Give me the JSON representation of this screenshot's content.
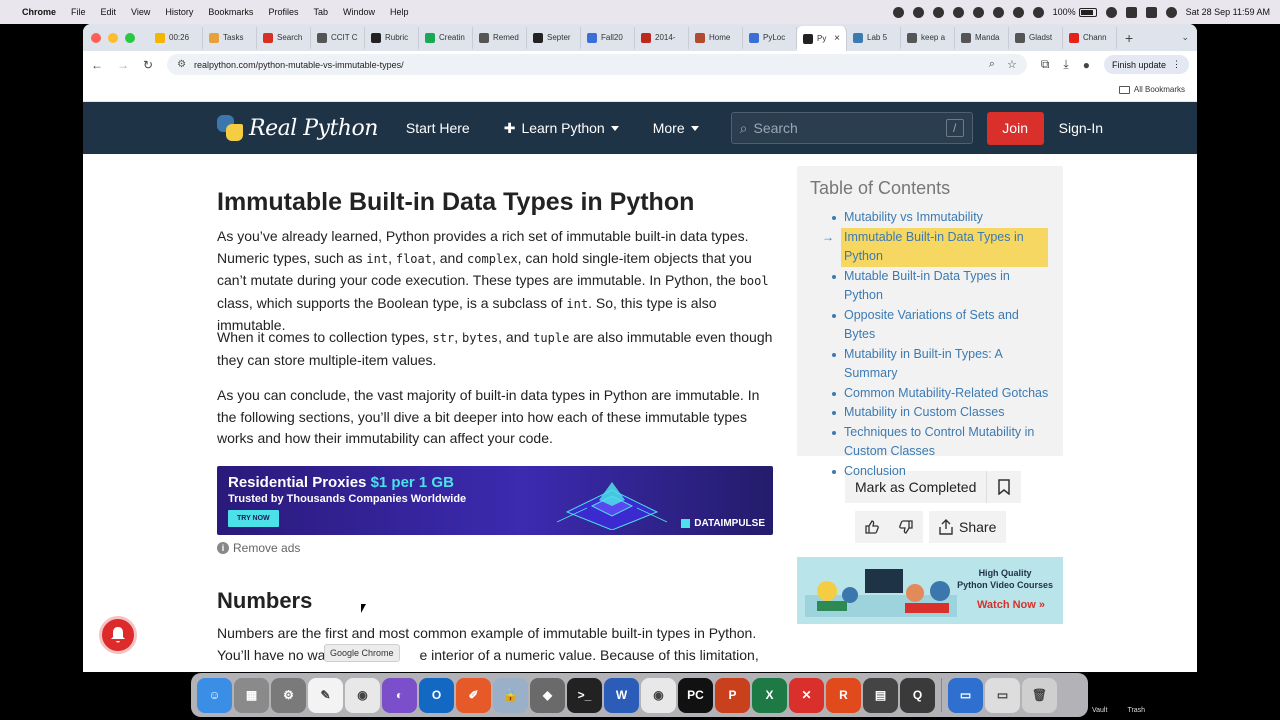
{
  "menubar": {
    "app": "Chrome",
    "items": [
      "File",
      "Edit",
      "View",
      "History",
      "Bookmarks",
      "Profiles",
      "Tab",
      "Window",
      "Help"
    ],
    "battery": "100%",
    "datetime": "Sat 28 Sep  11:59 AM"
  },
  "tabs": [
    {
      "label": "00:26",
      "color": "#f4b400"
    },
    {
      "label": "Tasks",
      "color": "#e8a13a"
    },
    {
      "label": "Search",
      "color": "#d93025"
    },
    {
      "label": "CCIT C",
      "color": "#555555"
    },
    {
      "label": "Rubric",
      "color": "#222222"
    },
    {
      "label": "Creatin",
      "color": "#18a957"
    },
    {
      "label": "Remed",
      "color": "#555555"
    },
    {
      "label": "Septer",
      "color": "#222222"
    },
    {
      "label": "Fall20",
      "color": "#3a6fd8"
    },
    {
      "label": "2014-",
      "color": "#c0281e"
    },
    {
      "label": "Home",
      "color": "#b24a2e"
    },
    {
      "label": "PyLoc",
      "color": "#3a6fd8"
    },
    {
      "label": "Py",
      "color": "#222222",
      "active": true
    },
    {
      "label": "Lab 5",
      "color": "#3c7ab2"
    },
    {
      "label": "keep a",
      "color": "#555555"
    },
    {
      "label": "Manda",
      "color": "#555555"
    },
    {
      "label": "Gladst",
      "color": "#555555"
    },
    {
      "label": "Chann",
      "color": "#e62117"
    }
  ],
  "toolbar": {
    "url": "realpython.com/python-mutable-vs-immutable-types/",
    "finish_update": "Finish update",
    "all_bookmarks": "All Bookmarks"
  },
  "site": {
    "logo_text": "Real Python",
    "nav": {
      "start_here": "Start Here",
      "learn_python": "Learn Python",
      "more": "More",
      "search_placeholder": "Search",
      "search_key": "/",
      "join": "Join",
      "sign_in": "Sign-In"
    },
    "article": {
      "heading": "Immutable Built-in Data Types in Python",
      "p1": {
        "a": "As you’ve already learned, Python provides a rich set of immutable built-in data types. Numeric types, such as ",
        "c1": "int",
        "b": ", ",
        "c2": "float",
        "c": ", and ",
        "c3": "complex",
        "d": ", can hold single-item objects that you can’t mutate during your code execution. These types are immutable. In Python, the ",
        "c4": "bool",
        "e": " class, which supports the Boolean type, is a subclass of ",
        "c5": "int",
        "f": ". So, this type is also immutable."
      },
      "p2": {
        "a": "When it comes to collection types, ",
        "c1": "str",
        "b": ", ",
        "c2": "bytes",
        "c": ", and ",
        "c3": "tuple",
        "d": " are also immutable even though they can store multiple-item values."
      },
      "p3": "As you can conclude, the vast majority of built-in data types in Python are immutable. In the following sections, you’ll dive a bit deeper into how each of these immutable types works and how their immutability can affect your code.",
      "ad": {
        "title_a": "Residential Proxies ",
        "title_b": "$1 per 1 GB",
        "subtitle": "Trusted by Thousands Companies Worldwide",
        "cta": "TRY NOW",
        "brand": "DATAIMPULSE"
      },
      "remove_ads": "Remove ads",
      "subheading": "Numbers",
      "p4_line1": "Numbers are the first and most common example of immutable built-in types in Python.",
      "p4_line2a": "You’ll have no wa",
      "p4_line2b": "e interior of a numeric value. Because of this limitation, you"
    },
    "toc": {
      "title": "Table of Contents",
      "items": [
        "Mutability vs Immutability",
        "Immutable Built-in Data Types in Python",
        "Mutable Built-in Data Types in Python",
        "Opposite Variations of Sets and Bytes",
        "Mutability in Built-in Types: A Summary",
        "Common Mutability-Related Gotchas",
        "Mutability in Custom Classes",
        "Techniques to Control Mutability in Custom Classes",
        "Conclusion"
      ],
      "active_index": 1
    },
    "mark_completed": "Mark as Completed",
    "share": "Share",
    "promo": {
      "line1": "High Quality",
      "line2": "Python Video Courses",
      "cta": "Watch Now »"
    }
  },
  "tooltip": "Google Chrome",
  "dock": {
    "apps": [
      {
        "name": "finder",
        "color": "#3b8ee6",
        "glyph": "☺"
      },
      {
        "name": "launchpad",
        "color": "#8a8a8a",
        "glyph": "▦"
      },
      {
        "name": "settings",
        "color": "#7a7a7a",
        "glyph": "⚙"
      },
      {
        "name": "textedit",
        "color": "#f3f3f3",
        "glyph": "✎"
      },
      {
        "name": "chrome",
        "color": "#e8e8e8",
        "glyph": "◉"
      },
      {
        "name": "github",
        "color": "#7b4fc9",
        "glyph": "◐"
      },
      {
        "name": "outlook",
        "color": "#1368c4",
        "glyph": "O"
      },
      {
        "name": "pen",
        "color": "#e65a2a",
        "glyph": "✐"
      },
      {
        "name": "lock",
        "color": "#9ab0c8",
        "glyph": "🔒"
      },
      {
        "name": "sequel",
        "color": "#6a6a6a",
        "glyph": "◆"
      },
      {
        "name": "terminal",
        "color": "#222222",
        "glyph": ">_"
      },
      {
        "name": "word",
        "color": "#2b5db8",
        "glyph": "W"
      },
      {
        "name": "chrome2",
        "color": "#e8e8e8",
        "glyph": "◉"
      },
      {
        "name": "pycharm",
        "color": "#111111",
        "glyph": "PC"
      },
      {
        "name": "powerpoint",
        "color": "#c8401c",
        "glyph": "P"
      },
      {
        "name": "excel",
        "color": "#1e7a44",
        "glyph": "X"
      },
      {
        "name": "remote",
        "color": "#d9302b",
        "glyph": "✕"
      },
      {
        "name": "reader",
        "color": "#e04a1c",
        "glyph": "R"
      },
      {
        "name": "calculator",
        "color": "#444444",
        "glyph": "▤"
      },
      {
        "name": "quicktime",
        "color": "#3a3a3a",
        "glyph": "Q"
      }
    ],
    "right_apps": [
      {
        "name": "folder",
        "color": "#2f6fd0",
        "glyph": "▭"
      },
      {
        "name": "screen",
        "color": "#dddddd",
        "glyph": "▭"
      },
      {
        "name": "trash",
        "color": "#cfcfcf",
        "glyph": "🗑"
      }
    ],
    "labels": [
      "Vault",
      "Trash"
    ]
  }
}
